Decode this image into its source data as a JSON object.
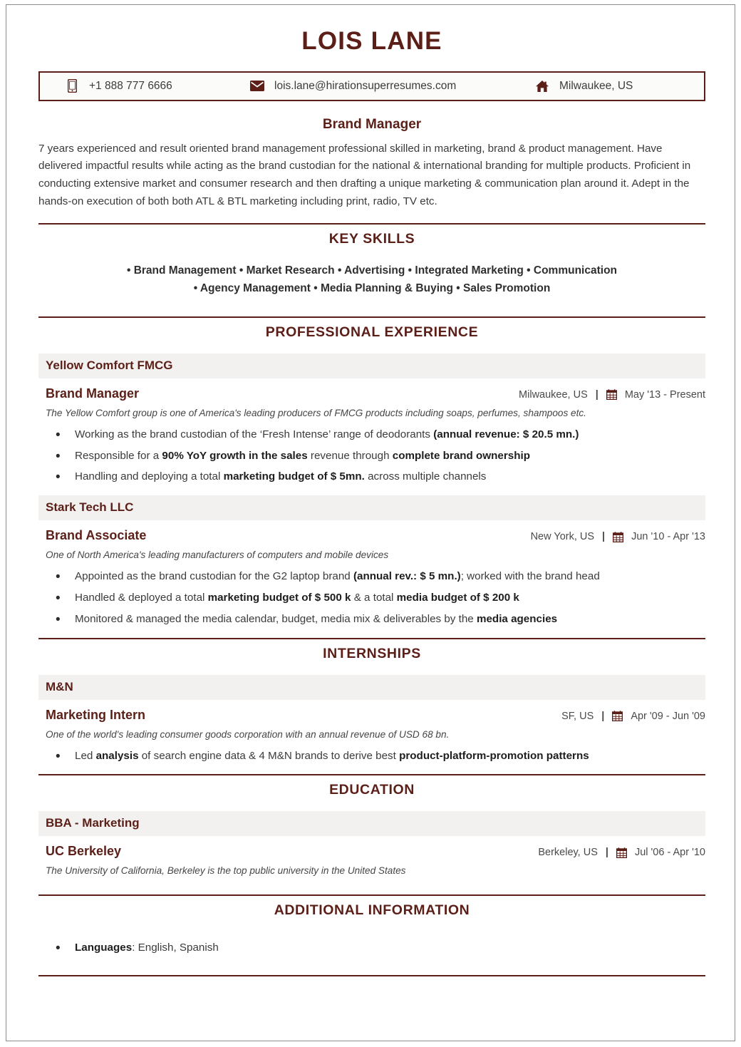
{
  "document_type": "resume",
  "accent_color": "#5b1f18",
  "company_bar_color": "#f2f1ef",
  "header": {
    "name": "LOIS LANE",
    "headline": "Brand Manager",
    "contact": {
      "phone": "+1 888 777 6666",
      "phone_icon": "mobile-phone-icon",
      "email": "lois.lane@hirationsuperresumes.com",
      "email_icon": "envelope-icon",
      "location": "Milwaukee, US",
      "location_icon": "home-icon"
    }
  },
  "summary": "7 years experienced and result oriented brand management professional skilled in marketing, brand & product management. Have delivered impactful results while acting as the brand custodian for the national & international branding for multiple products. Proficient in conducting extensive market and consumer research and then drafting a unique marketing & communication plan around it. Adept in the hands-on execution of both both ATL & BTL marketing including print, radio, TV etc.",
  "sections": {
    "key_skills": {
      "title": "KEY SKILLS",
      "lines": [
        "• Brand Management • Market Research • Advertising • Integrated Marketing • Communication",
        "• Agency Management • Media Planning & Buying • Sales Promotion"
      ]
    },
    "professional_experience": {
      "title": "PROFESSIONAL EXPERIENCE",
      "entries": [
        {
          "company": "Yellow Comfort FMCG",
          "role": "Brand Manager",
          "location": "Milwaukee, US",
          "separator": "|",
          "date_icon": "calendar-icon",
          "dates": "May '13 -  Present",
          "description": "The Yellow Comfort group is one of America's leading producers of FMCG products including soaps, perfumes, shampoos etc.",
          "bullets": [
            [
              {
                "t": "Working as the brand custodian of the ‘Fresh Intense’ range of deodorants ",
                "b": false
              },
              {
                "t": "(annual revenue: $ 20.5 mn.)",
                "b": true
              }
            ],
            [
              {
                "t": "Responsible for a ",
                "b": false
              },
              {
                "t": "90% YoY growth in the sales",
                "b": true
              },
              {
                "t": " revenue through ",
                "b": false
              },
              {
                "t": "complete brand ownership",
                "b": true
              }
            ],
            [
              {
                "t": "Handling and deploying a total ",
                "b": false
              },
              {
                "t": "marketing budget of $ 5mn.",
                "b": true
              },
              {
                "t": " across multiple channels",
                "b": false
              }
            ]
          ]
        },
        {
          "company": "Stark Tech LLC",
          "role": "Brand Associate",
          "location": "New York, US",
          "separator": "|",
          "date_icon": "calendar-icon",
          "dates": "Jun '10 -  Apr '13",
          "description": "One of North America's leading manufacturers of computers and mobile devices",
          "bullets": [
            [
              {
                "t": "Appointed as the brand custodian for the G2 laptop brand ",
                "b": false
              },
              {
                "t": "(annual rev.: $ 5 mn.)",
                "b": true
              },
              {
                "t": "; worked with the brand head",
                "b": false
              }
            ],
            [
              {
                "t": "Handled & deployed a total ",
                "b": false
              },
              {
                "t": "marketing budget of $ 500 k",
                "b": true
              },
              {
                "t": " & a total ",
                "b": false
              },
              {
                "t": "media budget of $ 200 k",
                "b": true
              }
            ],
            [
              {
                "t": "Monitored & managed the media calendar, budget, media mix & deliverables by the ",
                "b": false
              },
              {
                "t": "media agencies",
                "b": true
              }
            ]
          ]
        }
      ]
    },
    "internships": {
      "title": "INTERNSHIPS",
      "entries": [
        {
          "company": "M&N",
          "role": "Marketing Intern",
          "location": "SF, US",
          "separator": "|",
          "date_icon": "calendar-icon",
          "dates": "Apr '09 -  Jun '09",
          "description": "One of the world's leading consumer goods corporation with an annual revenue of USD 68 bn.",
          "bullets": [
            [
              {
                "t": "Led ",
                "b": false
              },
              {
                "t": "analysis",
                "b": true
              },
              {
                "t": " of search engine data & 4 M&N brands to derive best ",
                "b": false
              },
              {
                "t": "product-platform-promotion patterns",
                "b": true
              }
            ]
          ]
        }
      ]
    },
    "education": {
      "title": "EDUCATION",
      "entries": [
        {
          "company": "BBA - Marketing",
          "role": "UC Berkeley",
          "location": "Berkeley, US",
          "separator": "|",
          "date_icon": "calendar-icon",
          "dates": "Jul '06 -  Apr '10",
          "description": "The University of California, Berkeley is the top public university in the United States",
          "bullets": []
        }
      ]
    },
    "additional_information": {
      "title": "ADDITIONAL INFORMATION",
      "bullets": [
        [
          {
            "t": "Languages",
            "b": true
          },
          {
            "t": ": English, Spanish",
            "b": false
          }
        ]
      ]
    }
  }
}
